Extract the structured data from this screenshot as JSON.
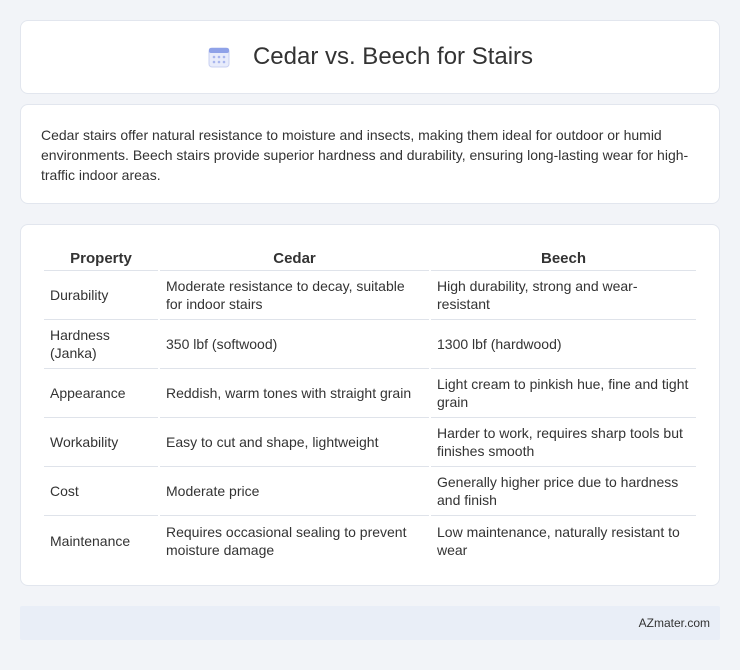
{
  "header": {
    "title": "Cedar vs. Beech for Stairs",
    "icon": "calendar-icon"
  },
  "intro": {
    "text": "Cedar stairs offer natural resistance to moisture and insects, making them ideal for outdoor or humid environments. Beech stairs provide superior hardness and durability, ensuring long-lasting wear for high-traffic indoor areas."
  },
  "table": {
    "headers": [
      "Property",
      "Cedar",
      "Beech"
    ],
    "rows": [
      [
        "Durability",
        "Moderate resistance to decay, suitable for indoor stairs",
        "High durability, strong and wear-resistant"
      ],
      [
        "Hardness (Janka)",
        "350 lbf (softwood)",
        "1300 lbf (hardwood)"
      ],
      [
        "Appearance",
        "Reddish, warm tones with straight grain",
        "Light cream to pinkish hue, fine and tight grain"
      ],
      [
        "Workability",
        "Easy to cut and shape, lightweight",
        "Harder to work, requires sharp tools but finishes smooth"
      ],
      [
        "Cost",
        "Moderate price",
        "Generally higher price due to hardness and finish"
      ],
      [
        "Maintenance",
        "Requires occasional sealing to prevent moisture damage",
        "Low maintenance, naturally resistant to wear"
      ]
    ]
  },
  "footer": {
    "text": "AZmater.com"
  }
}
